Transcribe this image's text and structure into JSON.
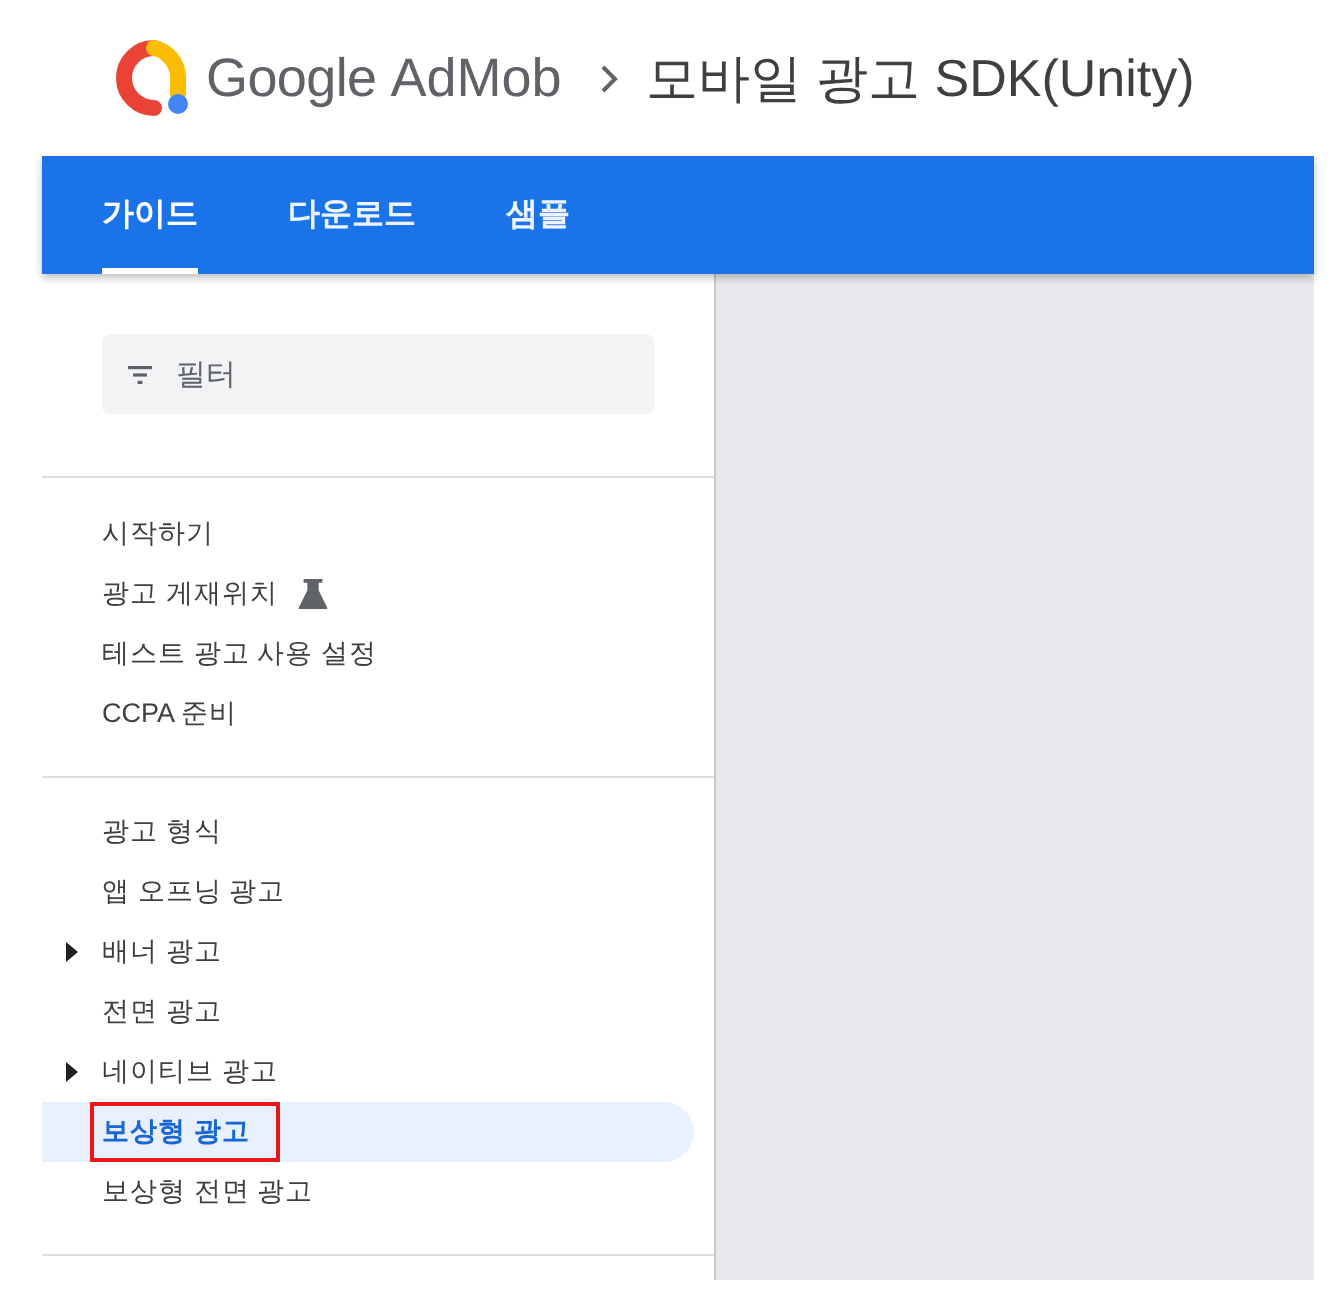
{
  "header": {
    "brand": "Google",
    "product": "AdMob",
    "page_title": "모바일 광고 SDK(Unity)"
  },
  "tabs": [
    {
      "label": "가이드",
      "selected": true
    },
    {
      "label": "다운로드",
      "selected": false
    },
    {
      "label": "샘플",
      "selected": false
    }
  ],
  "filter": {
    "placeholder": "필터"
  },
  "nav": {
    "sections": [
      {
        "items": [
          {
            "label": "시작하기",
            "expandable": false,
            "experimental": false,
            "selected": false,
            "annotated": false
          },
          {
            "label": "광고 게재위치",
            "expandable": false,
            "experimental": true,
            "selected": false,
            "annotated": false
          },
          {
            "label": "테스트 광고 사용 설정",
            "expandable": false,
            "experimental": false,
            "selected": false,
            "annotated": false
          },
          {
            "label": "CCPA 준비",
            "expandable": false,
            "experimental": false,
            "selected": false,
            "annotated": false
          }
        ]
      },
      {
        "items": [
          {
            "label": "광고 형식",
            "expandable": false,
            "experimental": false,
            "selected": false,
            "annotated": false
          },
          {
            "label": "앱 오프닝 광고",
            "expandable": false,
            "experimental": false,
            "selected": false,
            "annotated": false
          },
          {
            "label": "배너 광고",
            "expandable": true,
            "experimental": false,
            "selected": false,
            "annotated": false
          },
          {
            "label": "전면 광고",
            "expandable": false,
            "experimental": false,
            "selected": false,
            "annotated": false
          },
          {
            "label": "네이티브 광고",
            "expandable": true,
            "experimental": false,
            "selected": false,
            "annotated": false
          },
          {
            "label": "보상형 광고",
            "expandable": false,
            "experimental": false,
            "selected": true,
            "annotated": true
          },
          {
            "label": "보상형 전면 광고",
            "expandable": false,
            "experimental": false,
            "selected": false,
            "annotated": false
          }
        ]
      }
    ]
  }
}
